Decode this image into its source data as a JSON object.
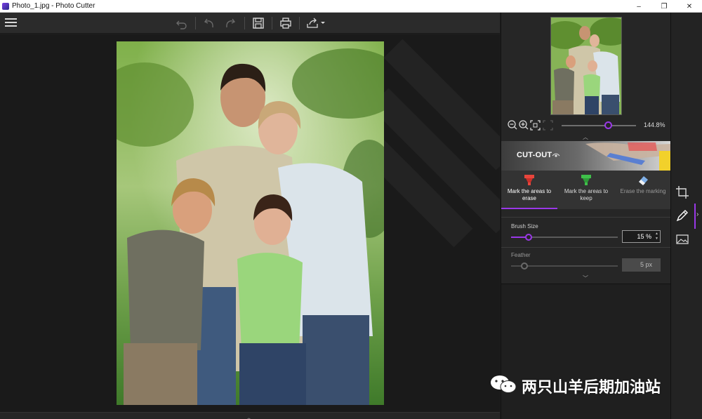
{
  "window": {
    "title": "Photo_1.jpg - Photo Cutter",
    "controls": {
      "minimize": "–",
      "maximize": "❐",
      "close": "✕"
    }
  },
  "toolbar": {
    "icons": [
      "menu-icon",
      "undo-all-icon",
      "undo-icon",
      "redo-icon",
      "save-icon",
      "print-icon",
      "share-icon"
    ]
  },
  "navigator": {
    "zoom_value": "144.8%",
    "zoom_level": 0.6,
    "icons": [
      "zoom-out-icon",
      "zoom-in-icon",
      "fit-icon",
      "actual-size-icon"
    ]
  },
  "cutout": {
    "label": "CUT-OUT"
  },
  "tools": [
    {
      "label": "Mark the areas to erase",
      "icon": "red-marker-icon",
      "active": true
    },
    {
      "label": "Mark the areas to keep",
      "icon": "green-marker-icon",
      "active": false
    },
    {
      "label": "Erase the marking",
      "icon": "eraser-icon",
      "active": false
    }
  ],
  "brush": {
    "label": "Brush Size",
    "value": "15 %",
    "level": 0.15
  },
  "feather": {
    "label": "Feather",
    "value": "5 px",
    "level": 0.1
  },
  "sidebar": {
    "icons": [
      "crop-icon",
      "brush-icon",
      "image-icon"
    ]
  },
  "watermark": {
    "text": "两只山羊后期加油站",
    "icon": "wechat-icon"
  },
  "colors": {
    "accent": "#9a38e8",
    "panel_bg": "#262626",
    "canvas_bg": "#1a1a1a"
  }
}
